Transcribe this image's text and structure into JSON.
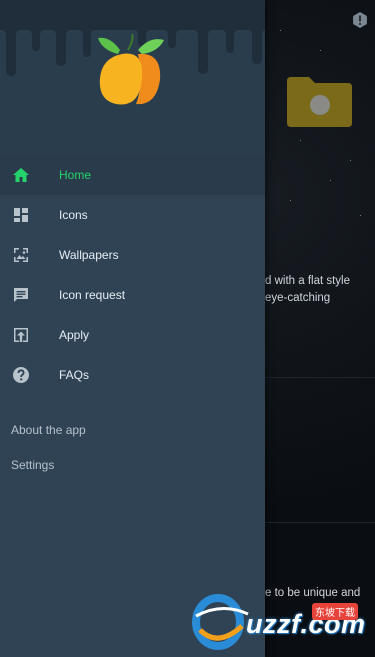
{
  "drawer": {
    "menu": [
      {
        "label": "Home",
        "icon": "home-icon",
        "active": true
      },
      {
        "label": "Icons",
        "icon": "dashboard-icon",
        "active": false
      },
      {
        "label": "Wallpapers",
        "icon": "wallpaper-icon",
        "active": false
      },
      {
        "label": "Icon request",
        "icon": "chat-icon",
        "active": false
      },
      {
        "label": "Apply",
        "icon": "apply-icon",
        "active": false
      },
      {
        "label": "FAQs",
        "icon": "help-icon",
        "active": false
      }
    ],
    "secondary": [
      {
        "label": "About the app"
      },
      {
        "label": "Settings"
      }
    ]
  },
  "background": {
    "text_line_1": "d with a flat style",
    "text_line_2": " eye-catching",
    "text_line_3": "e to be unique and"
  },
  "watermark": {
    "logo_text": "uzzf.com",
    "tagline": "东坡下载"
  },
  "colors": {
    "accent": "#25d36b",
    "drawer_bg": "#2f4354",
    "header_bg": "#2a3d4d",
    "mango_yellow": "#f7b320",
    "mango_orange": "#f08c1c",
    "leaf_green": "#5cc14a"
  }
}
